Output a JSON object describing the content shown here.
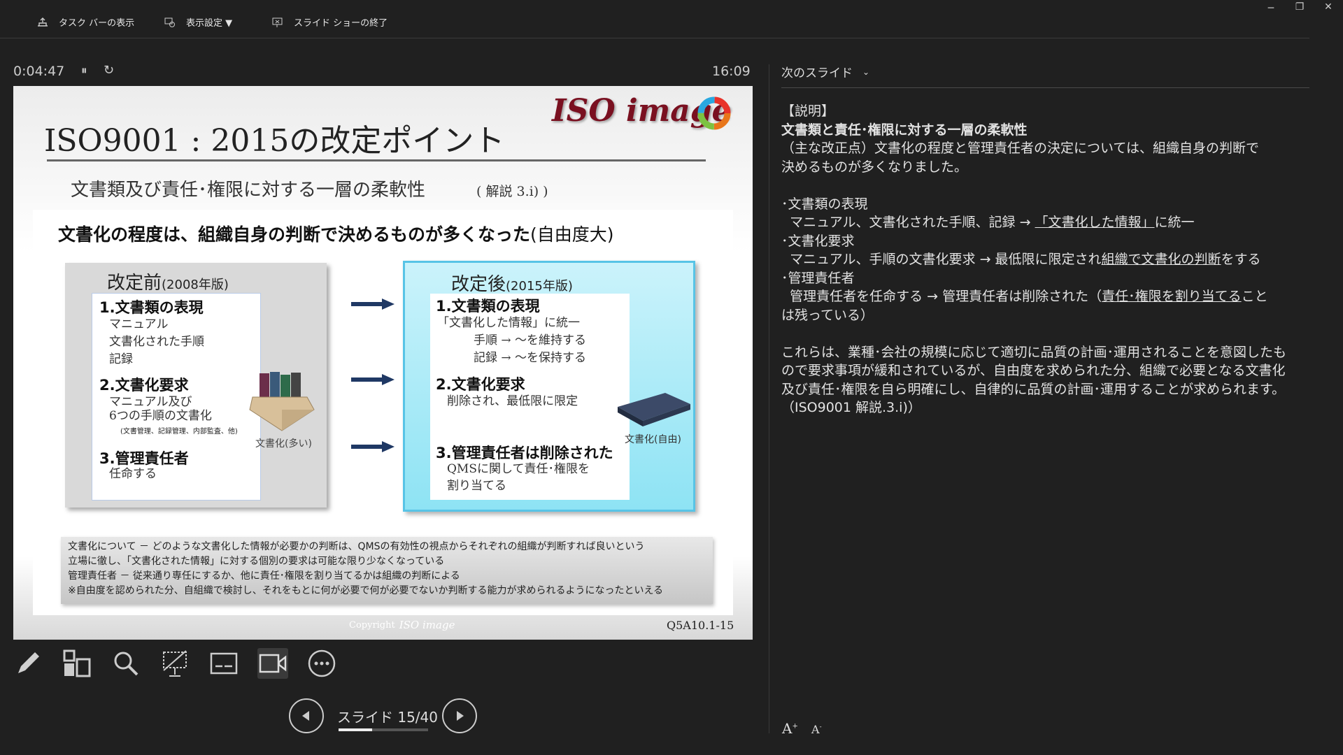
{
  "toolbar": {
    "taskbar_label": "タスク バーの表示",
    "display_settings_label": "表示設定 ▼",
    "end_show_label": "スライド ショーの終了"
  },
  "presenter": {
    "elapsed": "0:04:47",
    "clock": "16:09",
    "next_slide_label": "次のスライド"
  },
  "slide": {
    "title": "ISO9001 : 2015の改定ポイント",
    "logo_text": "ISO image",
    "subtitle": "文書類及び責任･権限に対する一層の柔軟性",
    "subtitle_ref": "( 解説 3.i) )",
    "headline": "文書化の程度は、組織自身の判断で決めるものが多くなった",
    "headline_note": "(自由度大)",
    "before": {
      "title": "改定前",
      "year": "(2008年版)",
      "h1": "1.文書類の表現",
      "t1": [
        "マニュアル",
        "文書化された手順",
        "記録"
      ],
      "h2": "2.文書化要求",
      "t2": [
        "マニュアル及び",
        "6つの手順の文書化"
      ],
      "t2_small": "(文書管理、記録管理、内部監査、他)",
      "h3": "3.管理責任者",
      "t3": "任命する",
      "caption": "文書化(多い)"
    },
    "after": {
      "title": "改定後",
      "year": "(2015年版)",
      "h1": "1.文書類の表現",
      "t1": [
        "「文書化した情報」に統一",
        "手順 → ～を維持する",
        "記録 → ～を保持する"
      ],
      "h2": "2.文書化要求",
      "t2": "削除され、最低限に限定",
      "h3": "3.管理責任者は削除された",
      "t3": [
        "QMSに関して責任･権限を",
        "割り当てる"
      ],
      "caption": "文書化(自由)"
    },
    "footnotes": [
      "文書化について － どのような文書化した情報が必要かの判断は、QMSの有効性の視点からそれぞれの組織が判断すれば良いという",
      "立場に徹し、「文書化された情報」に対する個別の要求は可能な限り少なくなっている",
      "管理責任者 － 従来通り専任にするか、他に責任･権限を割り当てるかは組織の判断による",
      "※自由度を認められた分、自組織で検討し、それをもとに何が必要で何が必要でないか判断する能力が求められるようになったといえる"
    ],
    "copyright": "Copyright",
    "copyright_logo": "ISO image",
    "slide_code": "Q5A10.1-15"
  },
  "notes": {
    "l1": "【説明】",
    "l2": "文書類と責任･権限に対する一層の柔軟性",
    "l3": "（主な改正点）文書化の程度と管理責任者の決定については、組織自身の判断で",
    "l4": "決めるものが多くなりました。",
    "l5": "･文書類の表現",
    "l6a": "マニュアル、文書化された手順、記録 → ",
    "l6b": "「文書化した情報」",
    "l6c": "に統一",
    "l7": "･文書化要求",
    "l8a": "マニュアル、手順の文書化要求 → 最低限に限定され",
    "l8b": "組織で文書化の判断",
    "l8c": "をする",
    "l9": "･管理責任者",
    "l10a": "管理責任者を任命する → 管理責任者は削除された（",
    "l10b": "責任･権限を割り当てる",
    "l10c": "こと",
    "l11": "は残っている）",
    "l12": "これらは、業種･会社の規模に応じて適切に品質の計画･運用されることを意図したも",
    "l13": "ので要求事項が緩和されているが、自由度を求められた分、組織で必要となる文書化",
    "l14": "及び責任･権限を自ら明確にし、自律的に品質の計画･運用することが求められます。",
    "l15": "（ISO9001 解説.3.i)）"
  },
  "nav": {
    "slide_counter": "スライド 15/40",
    "progress": 0.375
  }
}
